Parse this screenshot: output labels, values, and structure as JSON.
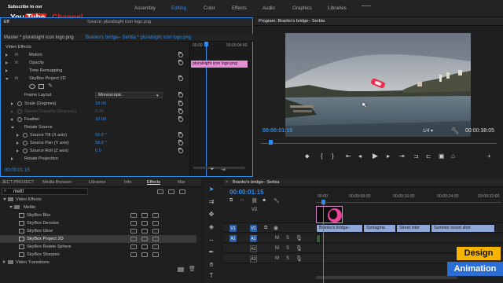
{
  "branding": {
    "subscribe": "Subscribe to our",
    "youtube_you": "You",
    "youtube_tube": "Tube",
    "channel": "Channel",
    "corner_line1": "Design",
    "corner_line2": "Animation"
  },
  "workspaces": [
    {
      "label": "Assembly",
      "active": false
    },
    {
      "label": "Editing",
      "active": true
    },
    {
      "label": "Color",
      "active": false
    },
    {
      "label": "Effects",
      "active": false
    },
    {
      "label": "Audio",
      "active": false
    },
    {
      "label": "Graphics",
      "active": false
    },
    {
      "label": "Libraries",
      "active": false
    }
  ],
  "effect_controls": {
    "tab_prefix": "Eff",
    "source_label": "Source: pluralsight icon logo.png",
    "master_label": "Master * pluralsight icon logo.png",
    "sequence_label": "Branko's bridge– Serbia * pluralsight icon logo.png",
    "clip_label": "pluralsight icon logo.png",
    "section_video_effects": "Video Effects",
    "motion": "Motion",
    "opacity": "Opacity",
    "time_remapping": "Time Remapping",
    "skybox": "SkyBox Project 2D",
    "frame_layout_label": "Frame Layout",
    "frame_layout_value": "Monoscopic",
    "scale_label": "Scale (Degrees)",
    "scale_value": "18.00",
    "stereo_label": "Stereo Disparity (Degrees)",
    "stereo_value": "0.00",
    "feather_label": "Feather",
    "feather_value": "10.00",
    "rotate_source": "Rotate Source",
    "tilt_label": "Source Tilt (X axis)",
    "tilt_value": "59.0 °",
    "pan_label": "Source Pan (Y axis)",
    "pan_value": "58.0 °",
    "roll_label": "Source Roll (Z axis)",
    "roll_value": "0.0",
    "rotate_projection": "Rotate Projection",
    "ruler_start": "00:00",
    "ruler_mark": "00:00:04:00",
    "timecode": "00:00:01:15"
  },
  "program": {
    "title": "Program: Branko's bridge– Serbia",
    "timecode": "00:00:01:15",
    "zoom": "1/4",
    "duration": "00:00:38:05"
  },
  "project_panel": {
    "tabs": [
      {
        "label": "JECT PROJECT",
        "active": false
      },
      {
        "label": "Media Browser",
        "active": false
      },
      {
        "label": "Libraries",
        "active": false
      },
      {
        "label": "Info",
        "active": false
      },
      {
        "label": "Effects",
        "active": true
      },
      {
        "label": "Mar",
        "active": false
      }
    ],
    "search_value": "mettl",
    "rows": [
      {
        "label": "Video Effects",
        "indent": 0,
        "folder": true
      },
      {
        "label": "Mettle",
        "indent": 1,
        "folder": true
      },
      {
        "label": "SkyBox Blur",
        "indent": 2,
        "folder": false,
        "selected": false
      },
      {
        "label": "SkyBox Denoise",
        "indent": 2,
        "folder": false,
        "selected": false
      },
      {
        "label": "SkyBox Glow",
        "indent": 2,
        "folder": false,
        "selected": false
      },
      {
        "label": "SkyBox Project 2D",
        "indent": 2,
        "folder": false,
        "selected": true
      },
      {
        "label": "SkyBox Rotate Sphere",
        "indent": 2,
        "folder": false,
        "selected": false
      },
      {
        "label": "SkyBox Sharpen",
        "indent": 2,
        "folder": false,
        "selected": false
      },
      {
        "label": "Video Transitions",
        "indent": 0,
        "folder": true
      }
    ]
  },
  "timeline": {
    "sequence_name": "Branko's bridge– Serbia",
    "timecode": "00:00:01:15",
    "ruler": [
      "00:00",
      "00:00:08:00",
      "00:00:16:00",
      "00:00:24:00",
      "00:00:32:00"
    ],
    "tracks": [
      {
        "id": "V2",
        "type": "video"
      },
      {
        "id": "V1",
        "type": "video",
        "patch": "V1"
      },
      {
        "id": "A1",
        "type": "audio",
        "patch": "A1"
      },
      {
        "id": "A2",
        "type": "audio"
      },
      {
        "id": "A3",
        "type": "audio"
      }
    ],
    "clips_v1": [
      "Branko's bridge–",
      "Syntagma",
      "Street inter",
      "Summer resort shot"
    ],
    "track_letters": [
      "M",
      "S"
    ]
  },
  "colors": {
    "accent": "#2d8ceb",
    "playhead": "#2d8ceb",
    "pink": "#e9449a",
    "clip_blue": "#8fa7d6",
    "clip_pink": "#d58ac5"
  }
}
